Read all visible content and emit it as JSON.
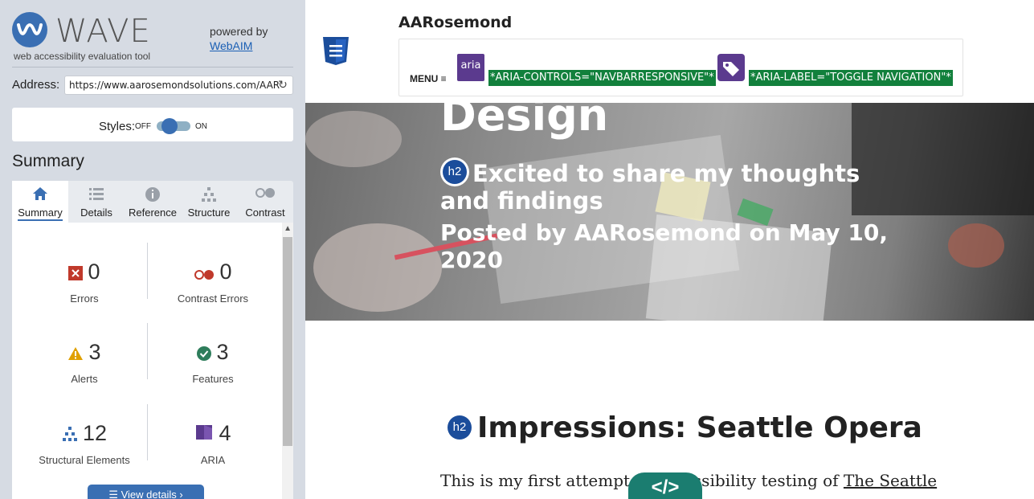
{
  "wave": {
    "logo_text": "WAVE",
    "tagline": "web accessibility evaluation tool",
    "powered_by": "powered by",
    "webaim_link": "WebAIM",
    "address_label": "Address:",
    "address_value": "https://www.aarosemondsolutions.com/AAR",
    "styles_label": "Styles:",
    "styles_off": "OFF",
    "styles_on": "ON",
    "summary_heading": "Summary",
    "tabs": [
      {
        "label": "Summary",
        "icon": "home-icon",
        "active": true
      },
      {
        "label": "Details",
        "icon": "list-icon",
        "active": false
      },
      {
        "label": "Reference",
        "icon": "info-icon",
        "active": false
      },
      {
        "label": "Structure",
        "icon": "structure-icon",
        "active": false
      },
      {
        "label": "Contrast",
        "icon": "contrast-icon",
        "active": false
      }
    ],
    "stats": {
      "errors": {
        "count": "0",
        "label": "Errors",
        "color": "#c0392b"
      },
      "contrast_errors": {
        "count": "0",
        "label": "Contrast Errors",
        "color": "#c0392b"
      },
      "alerts": {
        "count": "3",
        "label": "Alerts",
        "color": "#e0a000"
      },
      "features": {
        "count": "3",
        "label": "Features",
        "color": "#2e7d5b"
      },
      "structural": {
        "count": "12",
        "label": "Structural Elements",
        "color": "#3a6fb3"
      },
      "aria": {
        "count": "4",
        "label": "ARIA",
        "color": "#5b3a8e"
      }
    },
    "view_details": "View details ›"
  },
  "page": {
    "brand": "AARosemond",
    "menu_label": "MENU ≡",
    "aria_icon_text": "aria",
    "aria_controls_note": "*ARIA-CONTROLS=\"NAVBARRESPONSIVE\"*",
    "aria_label_note": "*ARIA-LABEL=\"TOGGLE NAVIGATION\"*",
    "hero_title": "Design",
    "h2_badge": "h2",
    "hero_subtitle": "Excited to share my thoughts and findings",
    "posted_by": "Posted by AARosemond on May 10, 2020",
    "section_heading": "Impressions: Seattle Opera",
    "body_text_start": "This is my first attempt at accessibility testing of ",
    "body_link": "The Seattle",
    "code_button": "</>"
  }
}
